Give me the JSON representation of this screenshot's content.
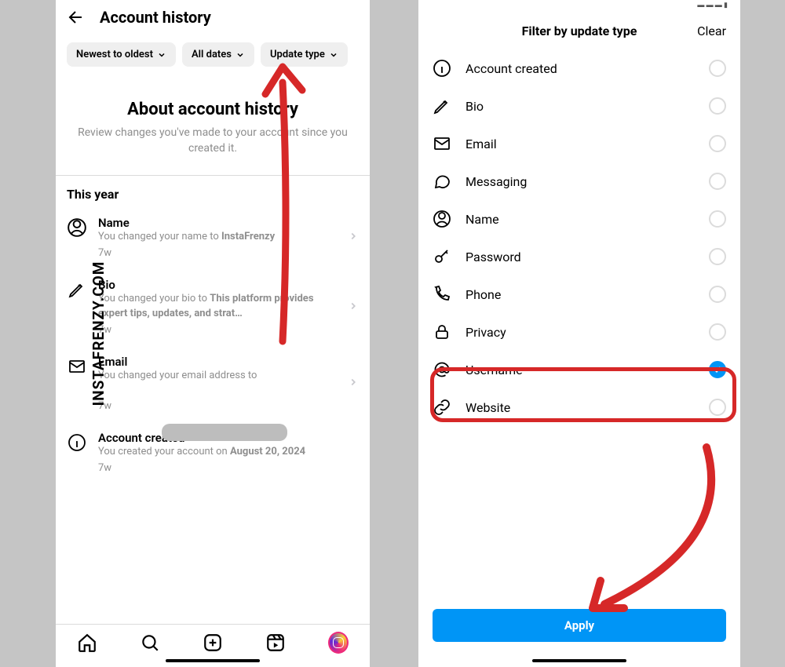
{
  "watermark": "INSTAFRENZY.COM",
  "left": {
    "header": "Account history",
    "filters": {
      "sort": "Newest to oldest",
      "dates": "All dates",
      "type": "Update type"
    },
    "about": {
      "title": "About account history",
      "subtitle": "Review changes you've made to your account since you created it."
    },
    "section": "This year",
    "items": [
      {
        "title": "Name",
        "desc_prefix": "You changed your name to ",
        "desc_bold": "InstaFrenzy",
        "time": "7w"
      },
      {
        "title": "Bio",
        "desc_prefix": "You changed your bio to ",
        "desc_bold": "This platform provides expert tips, updates, and strat…",
        "time": "7w"
      },
      {
        "title": "Email",
        "desc_prefix": "You changed your email address to",
        "desc_bold": "",
        "time": "7w"
      },
      {
        "title": "Account created",
        "desc_prefix": "You created your account on ",
        "desc_bold": "August 20, 2024",
        "time": "7w"
      }
    ]
  },
  "right": {
    "title": "Filter by update type",
    "clear": "Clear",
    "options": [
      "Account created",
      "Bio",
      "Email",
      "Messaging",
      "Name",
      "Password",
      "Phone",
      "Privacy",
      "Username",
      "Website"
    ],
    "selected": "Username",
    "apply": "Apply"
  }
}
